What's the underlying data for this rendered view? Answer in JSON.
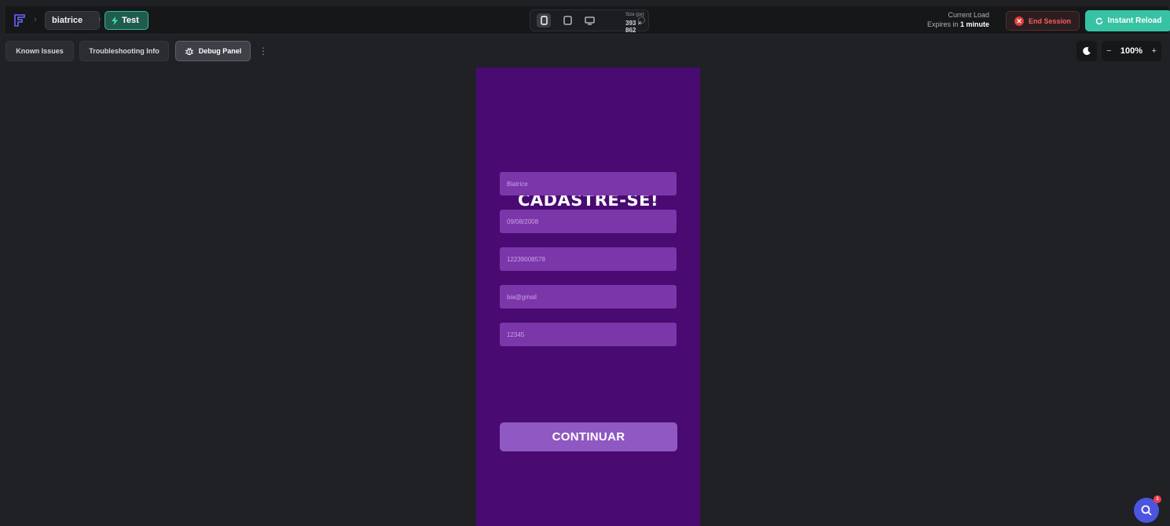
{
  "topbar": {
    "project_name": "biatrice",
    "branch_label": "Test",
    "device": {
      "size_caption": "Size (px)",
      "size_value": "393 × 862"
    },
    "load": {
      "title": "Current Load",
      "expires_prefix": "Expires in",
      "expires_value": "1 minute"
    },
    "end_session_label": "End Session",
    "instant_reload_label": "Instant Reload"
  },
  "tabs": [
    {
      "label": "Known Issues"
    },
    {
      "label": "Troubleshooting Info"
    },
    {
      "label": "Debug Panel"
    }
  ],
  "zoom": {
    "value": "100%",
    "minus": "−",
    "plus": "+"
  },
  "app": {
    "title": "CADASTRE-SE!",
    "fields": [
      {
        "value": "Biatrice"
      },
      {
        "value": "09/08/2008"
      },
      {
        "value": "12239008578"
      },
      {
        "value": "bia@gmail"
      },
      {
        "value": "12345"
      }
    ],
    "continue_label": "CONTINUAR",
    "background_color": "#490a72",
    "field_color": "#7b36aa",
    "button_color": "#8f58c2"
  },
  "help": {
    "badge_count": "1"
  },
  "colors": {
    "accent": "#37c3a3",
    "danger": "#e23b3b",
    "editor_bg": "#1f2124"
  },
  "icons": {
    "logo": "flutterflow-logo-icon",
    "branch": "lightning-icon",
    "devices": [
      "phone-icon",
      "tablet-icon",
      "desktop-icon"
    ],
    "theme": "moon-icon",
    "help": "search-icon"
  }
}
